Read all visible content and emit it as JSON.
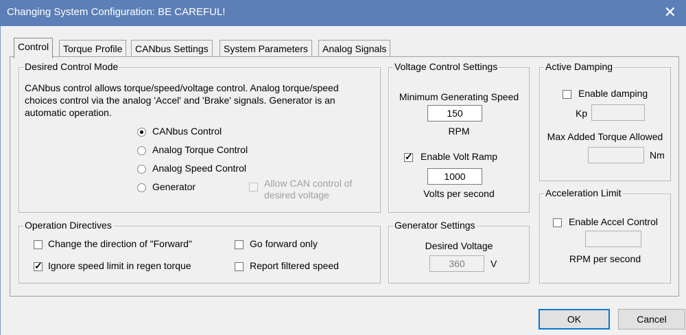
{
  "window": {
    "title": "Changing System Configuration: BE CAREFUL!"
  },
  "tabs": [
    {
      "label": "Control"
    },
    {
      "label": "Torque Profile"
    },
    {
      "label": "CANbus Settings"
    },
    {
      "label": "System Parameters"
    },
    {
      "label": "Analog Signals"
    }
  ],
  "desired_control_mode": {
    "title": "Desired Control Mode",
    "description_lines": [
      "CANbus control allows torque/speed/voltage control.  Analog torque/speed",
      "choices control via the analog 'Accel' and 'Brake' signals.  Generator is an",
      "automatic operation."
    ],
    "options": [
      {
        "label": "CANbus Control",
        "selected": true
      },
      {
        "label": "Analog Torque Control",
        "selected": false
      },
      {
        "label": "Analog Speed Control",
        "selected": false
      },
      {
        "label": "Generator",
        "selected": false
      }
    ],
    "allow_can_lines": [
      "Allow CAN control of",
      "desired voltage"
    ]
  },
  "operation_directives": {
    "title": "Operation Directives",
    "change_forward": {
      "label": "Change the direction of \"Forward\"",
      "checked": false
    },
    "ignore_speed": {
      "label": "Ignore speed limit in regen torque",
      "checked": true
    },
    "forward_only": {
      "label": "Go forward only",
      "checked": false
    },
    "report_filtered": {
      "label": "Report filtered speed",
      "checked": false
    }
  },
  "voltage_control": {
    "title": "Voltage Control Settings",
    "min_gen_label": "Minimum Generating Speed",
    "min_gen_value": "150",
    "rpm_unit": "RPM",
    "enable_volt_ramp": {
      "label": "Enable Volt Ramp",
      "checked": true
    },
    "ramp_value": "1000",
    "ramp_unit": "Volts per second"
  },
  "generator_settings": {
    "title": "Generator Settings",
    "desired_voltage_label": "Desired Voltage",
    "desired_voltage_value": "360",
    "voltage_unit": "V"
  },
  "active_damping": {
    "title": "Active Damping",
    "enable": {
      "label": "Enable damping",
      "checked": false
    },
    "kp_label": "Kp",
    "kp_value": "",
    "max_torque_label": "Max Added Torque Allowed",
    "max_torque_value": "",
    "torque_unit": "Nm"
  },
  "acceleration_limit": {
    "title": "Acceleration Limit",
    "enable": {
      "label": "Enable Accel Control",
      "checked": false
    },
    "accel_value": "",
    "accel_unit": "RPM per second"
  },
  "buttons": {
    "ok": "OK",
    "cancel": "Cancel"
  },
  "colors": {
    "titlebar": "#5b7fb6",
    "window_bg": "#f0f0f0",
    "default_button_border": "#0078d7"
  }
}
